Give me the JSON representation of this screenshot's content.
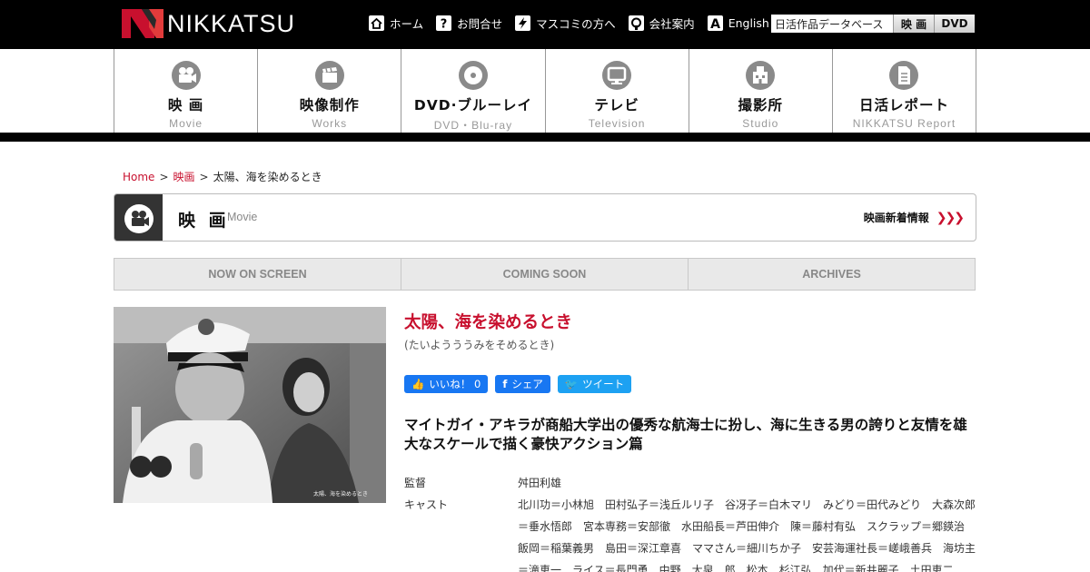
{
  "header": {
    "logo_text": "NIKKATSU",
    "links": [
      {
        "label": "ホーム",
        "icon": "home-icon"
      },
      {
        "label": "お問合せ",
        "icon": "question-icon"
      },
      {
        "label": "マスコミの方へ",
        "icon": "lightning-icon"
      },
      {
        "label": "会社案内",
        "icon": "building-icon"
      },
      {
        "label": "English",
        "icon": "letter-a-icon"
      }
    ],
    "search": {
      "value": "日活作品データベース",
      "buttons": [
        "映 画",
        "DVD"
      ]
    }
  },
  "nav": [
    {
      "jp": "映 画",
      "en": "Movie",
      "icon": "film-camera-icon"
    },
    {
      "jp": "映像制作",
      "en": "Works",
      "icon": "clapperboard-icon"
    },
    {
      "jp": "DVD·ブルーレイ",
      "en": "DVD・Blu-ray",
      "icon": "disc-icon"
    },
    {
      "jp": "テレビ",
      "en": "Television",
      "icon": "tv-icon"
    },
    {
      "jp": "撮影所",
      "en": "Studio",
      "icon": "studio-icon"
    },
    {
      "jp": "日活レポート",
      "en": "NIKKATSU Report",
      "icon": "document-icon"
    }
  ],
  "breadcrumb": {
    "home": "Home",
    "movie": "映画",
    "current": "太陽、海を染めるとき",
    "sep": ">"
  },
  "section": {
    "title": "映 画",
    "subtitle": "Movie",
    "link": "映画新着情報",
    "arrows": "❯❯❯"
  },
  "tabs": [
    "NOW ON SCREEN",
    "COMING SOON",
    "ARCHIVES"
  ],
  "movie": {
    "title": "太陽、海を染めるとき",
    "kana": "(たいようううみをそめるとき)",
    "still_caption": "太陽、海を染めるとき",
    "tagline": "マイトガイ・アキラが商船大学出の優秀な航海士に扮し、海に生きる男の誇りと友情を雄大なスケールで描く豪快アクション篇",
    "credits": [
      {
        "label": "監督",
        "value": "舛田利雄"
      },
      {
        "label": "キャスト",
        "value": "北川功＝小林旭　田村弘子＝浅丘ルリ子　谷冴子＝白木マリ　みどり＝田代みどり　大森次郎＝垂水悟郎　宮本専務＝安部徹　水田船長＝芦田伸介　陳＝藤村有弘　スクラップ＝郷鍈治　飯岡＝稲葉義男　島田＝深江章喜　ママさん＝細川ちか子　安芸海運社長＝嵯峨善兵　海坊主＝滝恵一　ライス＝長門勇　中野　大泉　郎　松本　杉江弘　加代＝新井麗子　土田恵二"
      }
    ]
  },
  "social": {
    "like": "いいね！ 0",
    "share": "シェア",
    "tweet": "ツイート"
  }
}
